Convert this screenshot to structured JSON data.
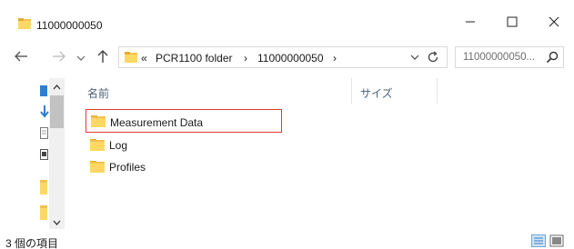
{
  "window": {
    "title": "11000000050",
    "controls": {
      "minimize_icon": "minimize-icon",
      "maximize_icon": "maximize-icon",
      "close_icon": "close-icon"
    }
  },
  "navigation": {
    "back_icon": "back-arrow-icon",
    "forward_icon": "forward-arrow-icon",
    "recent_icon": "chevron-down-icon",
    "up_icon": "up-arrow-icon"
  },
  "address": {
    "overflow": "«",
    "segments": [
      "PCR1100 folder",
      "11000000050"
    ],
    "separator": "›",
    "refresh_icon": "refresh-icon"
  },
  "search": {
    "placeholder": "11000000050...",
    "icon": "search-icon"
  },
  "columns": {
    "name": "名前",
    "size": "サイズ"
  },
  "items": [
    {
      "label": "Measurement Data",
      "highlighted": true
    },
    {
      "label": "Log",
      "highlighted": false
    },
    {
      "label": "Profiles",
      "highlighted": false
    }
  ],
  "status": {
    "item_count": "3 個の項目"
  },
  "colors": {
    "folder": "#f3c14d",
    "highlight": "#e53935",
    "accent": "#4a9ae0"
  }
}
